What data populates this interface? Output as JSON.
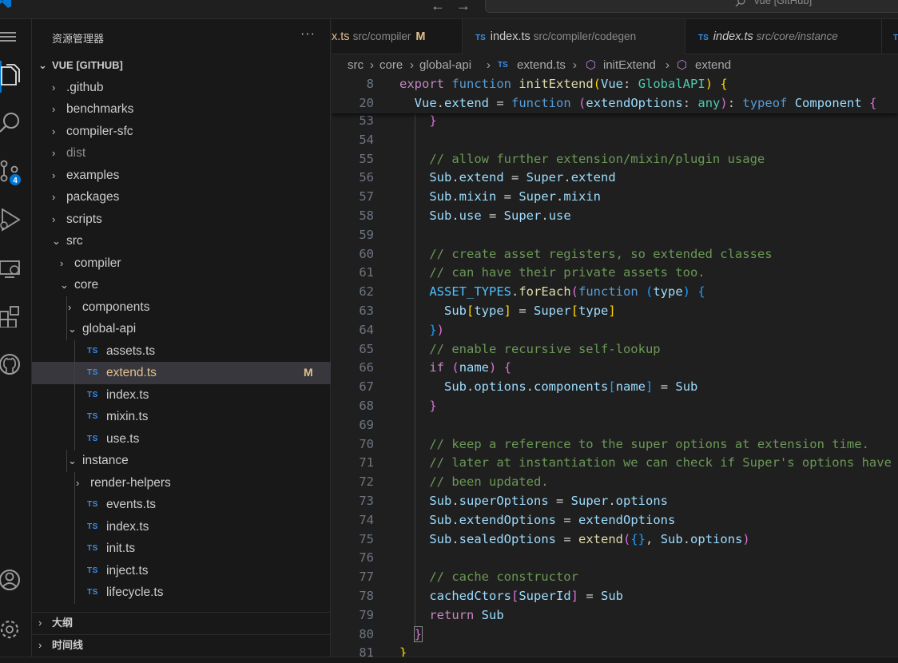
{
  "titlebar": {
    "command_center_text": "vue [GitHub]"
  },
  "activity_bar": {
    "scm_badge": "4"
  },
  "sidebar": {
    "title": "资源管理器",
    "more": "···",
    "root": "VUE [GITHUB]",
    "items": [
      {
        "label": ".github",
        "type": "folder"
      },
      {
        "label": "benchmarks",
        "type": "folder"
      },
      {
        "label": "compiler-sfc",
        "type": "folder"
      },
      {
        "label": "dist",
        "type": "folder"
      },
      {
        "label": "examples",
        "type": "folder"
      },
      {
        "label": "packages",
        "type": "folder"
      },
      {
        "label": "scripts",
        "type": "folder"
      },
      {
        "label": "src",
        "type": "folder"
      },
      {
        "label": "compiler",
        "type": "folder"
      },
      {
        "label": "core",
        "type": "folder"
      },
      {
        "label": "components",
        "type": "folder"
      },
      {
        "label": "global-api",
        "type": "folder"
      },
      {
        "label": "assets.ts",
        "type": "file"
      },
      {
        "label": "extend.ts",
        "type": "file",
        "status": "M"
      },
      {
        "label": "index.ts",
        "type": "file"
      },
      {
        "label": "mixin.ts",
        "type": "file"
      },
      {
        "label": "use.ts",
        "type": "file"
      },
      {
        "label": "instance",
        "type": "folder"
      },
      {
        "label": "render-helpers",
        "type": "folder"
      },
      {
        "label": "events.ts",
        "type": "file"
      },
      {
        "label": "index.ts",
        "type": "file"
      },
      {
        "label": "init.ts",
        "type": "file"
      },
      {
        "label": "inject.ts",
        "type": "file"
      },
      {
        "label": "lifecycle.ts",
        "type": "file"
      }
    ],
    "file_icon_text": "TS",
    "outline": "大纲",
    "timeline": "时间线"
  },
  "tabs": [
    {
      "name": "x.ts",
      "path": "src/compiler",
      "status": "M"
    },
    {
      "name": "index.ts",
      "path": "src/compiler/codegen"
    },
    {
      "name": "index.ts",
      "path": "src/core/instance"
    }
  ],
  "breadcrumb": [
    "src",
    "core",
    "global-api",
    "extend.ts",
    "initExtend",
    "extend"
  ],
  "colors": {
    "accent": "#0078d4",
    "modified": "#e2c08d",
    "ts_icon": "#3b8eea"
  }
}
